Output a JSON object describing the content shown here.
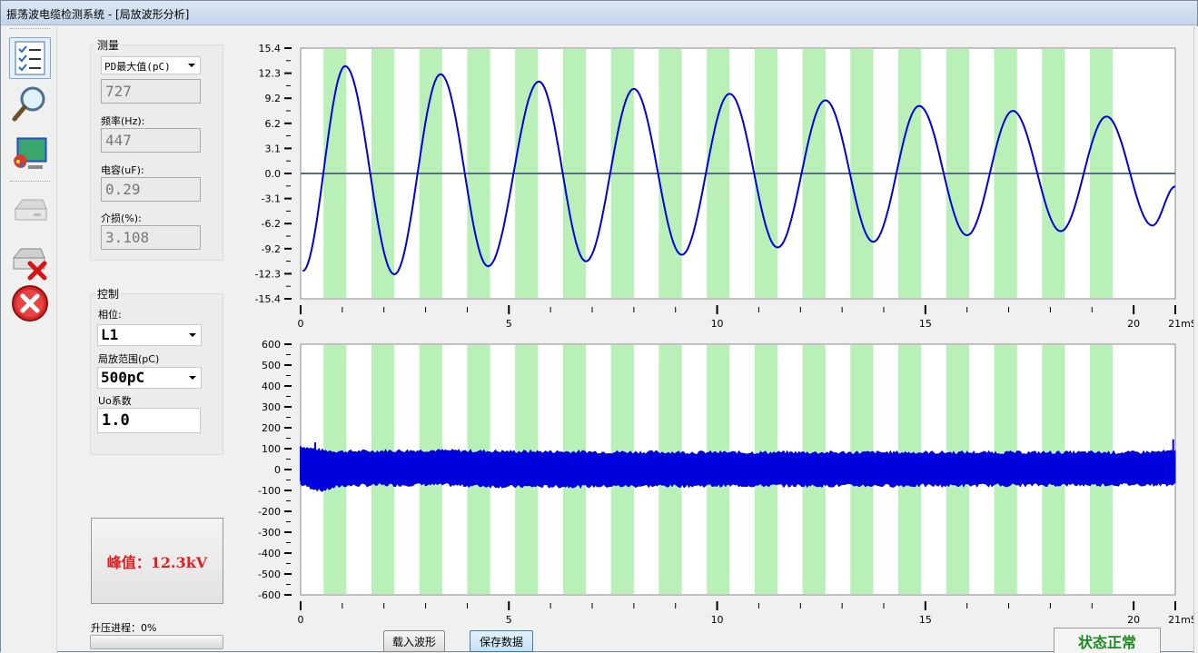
{
  "window": {
    "title": "振荡波电缆检测系统 - [局放波形分析]"
  },
  "toolbar": {
    "items": [
      {
        "name": "checklist-icon"
      },
      {
        "name": "magnifier-icon"
      },
      {
        "name": "monitor-palette-icon"
      },
      {
        "name": "drive-disabled-icon"
      },
      {
        "name": "drive-delete-icon"
      },
      {
        "name": "close-red-icon"
      }
    ]
  },
  "measure": {
    "group_label": "测量",
    "pd_select": "PD最大值(pC)",
    "pd_value": "727",
    "freq_label": "频率(Hz):",
    "freq_value": "447",
    "cap_label": "电容(uF):",
    "cap_value": "0.29",
    "loss_label": "介损(%):",
    "loss_value": "3.108"
  },
  "control": {
    "group_label": "控制",
    "phase_label": "相位:",
    "phase_value": "L1",
    "range_label": "局放范围(pC)",
    "range_value": "500pC",
    "uo_label": "Uo系数",
    "uo_value": "1.0"
  },
  "peak": {
    "text": "峰值：12.3kV"
  },
  "progress": {
    "label": "升压进程：0%",
    "value": 0
  },
  "buttons": {
    "load": "载入波形",
    "save": "保存数据"
  },
  "status": {
    "text": "状态正常"
  },
  "colors": {
    "band": "#b8f0b8",
    "trace": "#0000dd",
    "zero_line": "#5a6e80",
    "status": "#1d8a1d",
    "peak": "#e02020"
  },
  "chart_data": [
    {
      "type": "line",
      "name": "voltage-waveform",
      "x_unit": "mS",
      "xlim": [
        0,
        21
      ],
      "x_ticks": [
        0,
        5,
        10,
        15,
        20
      ],
      "x_tick_end_label": "21mS",
      "ylim": [
        -15.4,
        15.4
      ],
      "y_ticks": [
        "15.4",
        "12.3",
        "9.2",
        "6.2",
        "3.1",
        "0.0",
        "-3.1",
        "-6.2",
        "-9.2",
        "-12.3",
        "-15.4"
      ],
      "series": [
        {
          "frequency_hz": 447,
          "peaks": [
            {
              "x": 1.07,
              "y": 13.2
            },
            {
              "x": 2.25,
              "y": -12.4
            },
            {
              "x": 3.36,
              "y": 12.2
            },
            {
              "x": 4.5,
              "y": -11.4
            },
            {
              "x": 5.72,
              "y": 11.3
            },
            {
              "x": 6.85,
              "y": -10.8
            },
            {
              "x": 8.0,
              "y": 10.4
            },
            {
              "x": 9.15,
              "y": -10.0
            },
            {
              "x": 10.3,
              "y": 9.8
            },
            {
              "x": 11.45,
              "y": -9.1
            },
            {
              "x": 12.6,
              "y": 9.0
            },
            {
              "x": 13.75,
              "y": -8.4
            },
            {
              "x": 14.85,
              "y": 8.3
            },
            {
              "x": 16.0,
              "y": -7.6
            },
            {
              "x": 17.1,
              "y": 7.7
            },
            {
              "x": 18.25,
              "y": -7.1
            },
            {
              "x": 19.35,
              "y": 7.0
            },
            {
              "x": 20.45,
              "y": -6.4
            }
          ],
          "end": {
            "x": 21,
            "y": -1.6
          }
        }
      ],
      "bands_x": [
        [
          0.55,
          1.1
        ],
        [
          1.7,
          2.25
        ],
        [
          2.85,
          3.4
        ],
        [
          4.0,
          4.55
        ],
        [
          5.15,
          5.7
        ],
        [
          6.3,
          6.85
        ],
        [
          7.45,
          8.0
        ],
        [
          8.6,
          9.15
        ],
        [
          9.75,
          10.3
        ],
        [
          10.9,
          11.45
        ],
        [
          12.05,
          12.6
        ],
        [
          13.2,
          13.75
        ],
        [
          14.35,
          14.9
        ],
        [
          15.5,
          16.05
        ],
        [
          16.65,
          17.2
        ],
        [
          17.8,
          18.35
        ],
        [
          18.95,
          19.5
        ]
      ]
    },
    {
      "type": "area",
      "name": "pd-signal",
      "x_unit": "mS",
      "xlim": [
        0,
        21
      ],
      "x_ticks": [
        0,
        5,
        10,
        15,
        20
      ],
      "x_tick_end_label": "21mS",
      "ylim": [
        -600,
        600
      ],
      "y_ticks": [
        "600",
        "500",
        "400",
        "300",
        "200",
        "100",
        "0",
        "-100",
        "-200",
        "-300",
        "-400",
        "-500",
        "-600"
      ],
      "series": [
        {
          "noise_band_upper": [
            [
              0,
              110
            ],
            [
              0.5,
              90
            ],
            [
              1,
              85
            ],
            [
              3,
              90
            ],
            [
              5,
              85
            ],
            [
              10,
              80
            ],
            [
              15,
              80
            ],
            [
              20,
              80
            ],
            [
              21,
              85
            ]
          ],
          "noise_band_lower": [
            [
              0,
              -70
            ],
            [
              0.5,
              -100
            ],
            [
              1,
              -75
            ],
            [
              3,
              -70
            ],
            [
              5,
              -80
            ],
            [
              10,
              -75
            ],
            [
              15,
              -75
            ],
            [
              20,
              -70
            ],
            [
              21,
              -70
            ]
          ],
          "spikes": [
            {
              "x": 0.0,
              "y": 110
            },
            {
              "x": 0.35,
              "y": 130
            },
            {
              "x": 20.95,
              "y": 145
            }
          ]
        }
      ]
    }
  ]
}
